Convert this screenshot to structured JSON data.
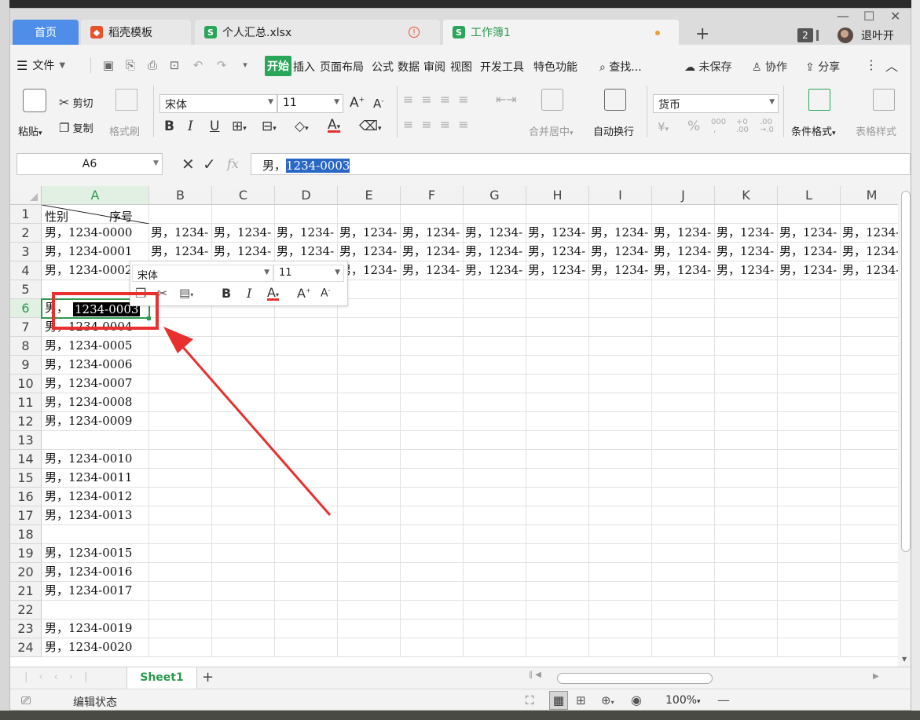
{
  "tabs": {
    "home": "首页",
    "daoke": "稻壳模板",
    "summary": "个人汇总.xlsx",
    "workbook": "工作簿1",
    "add": "+",
    "window_count": "2",
    "exit": "退叶开"
  },
  "menu": {
    "file": "文件",
    "tabs": [
      "开始",
      "插入",
      "页面布局",
      "公式",
      "数据",
      "审阅",
      "视图",
      "开发工具",
      "特色功能"
    ],
    "search": "查找...",
    "unsaved": "未保存",
    "collab": "协作",
    "share": "分享"
  },
  "ribbon": {
    "paste": "粘贴",
    "cut": "剪切",
    "copy": "复制",
    "format_painter": "格式刷",
    "font_name": "宋体",
    "font_size": "11",
    "merge_center": "合并居中",
    "wrap_text": "自动换行",
    "number_format": "货币",
    "cond_format": "条件格式",
    "table_style": "表格样式"
  },
  "formula_bar": {
    "name_box": "A6",
    "prefix": "男，",
    "selected": "1234-0003"
  },
  "grid": {
    "columns": [
      "A",
      "B",
      "C",
      "D",
      "E",
      "F",
      "G",
      "H",
      "I",
      "J",
      "K",
      "L",
      "M"
    ],
    "rows": [
      "1",
      "2",
      "3",
      "4",
      "5",
      "6",
      "7",
      "8",
      "9",
      "10",
      "11",
      "12",
      "13",
      "14",
      "15",
      "16",
      "17",
      "18",
      "19",
      "20",
      "21",
      "22",
      "23",
      "24"
    ],
    "header_sex": "性别",
    "header_seq": "序号",
    "fill_text": "男，1234-",
    "col_a": [
      "男，1234-0000",
      "男，1234-0001",
      "男，1234-0002",
      "",
      "男，",
      "男，1234-0004",
      "男，1234-0005",
      "男，1234-0006",
      "男，1234-0007",
      "男，1234-0008",
      "男，1234-0009",
      "",
      "男，1234-0010",
      "男，1234-0011",
      "男，1234-0012",
      "男，1234-0013",
      "",
      "男，1234-0015",
      "男，1234-0016",
      "男，1234-0017",
      "",
      "男，1234-0019",
      "男，1234-0020"
    ],
    "a6_selected": "1234-0003"
  },
  "mini_toolbar": {
    "font_name": "宋体",
    "font_size": "11"
  },
  "sheets": [
    "Sheet1"
  ],
  "status": {
    "mode": "编辑状态",
    "zoom": "100%"
  },
  "colors": {
    "accent_green": "#2aa65a",
    "annotation_red": "#e8312e",
    "tab_blue": "#4e8ee9"
  }
}
